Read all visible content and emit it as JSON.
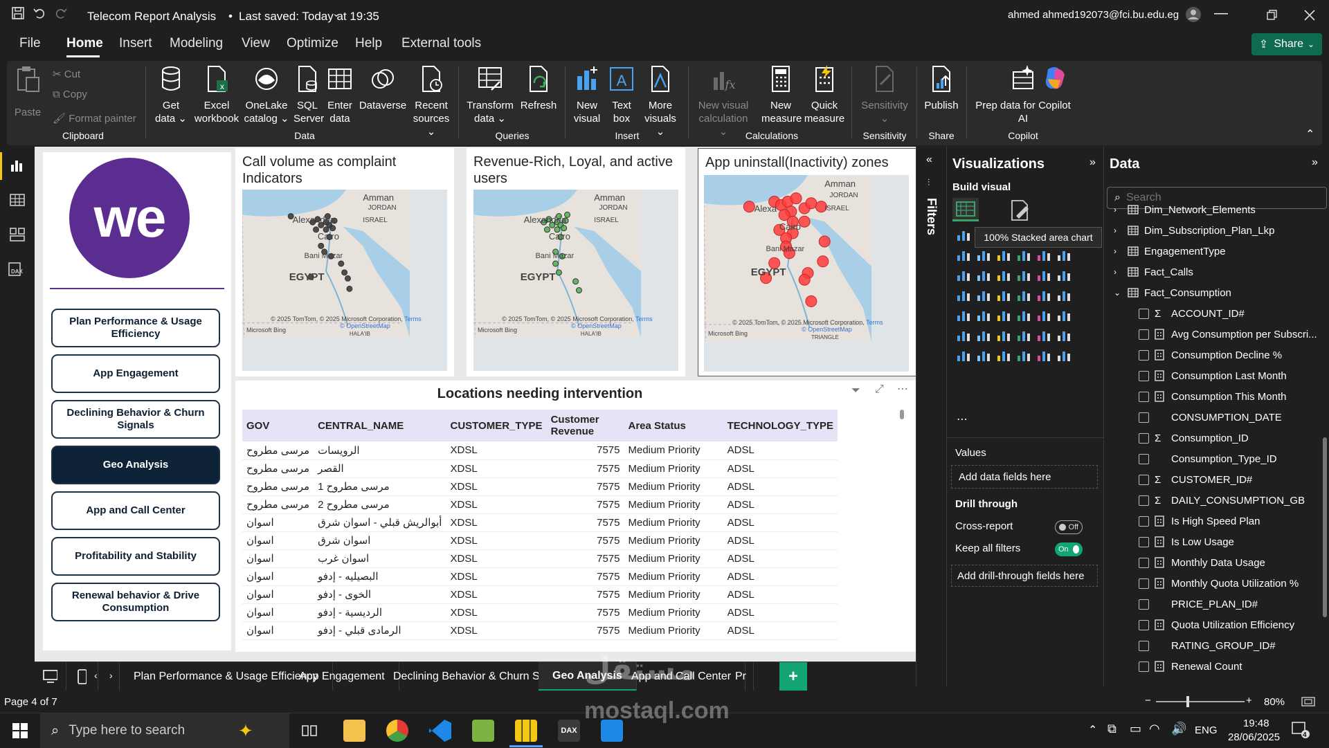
{
  "titlebar": {
    "title": "Telecom Report Analysis",
    "saved": "Last saved: Today at 19:35",
    "user": "ahmed ahmed192073@fci.bu.edu.eg"
  },
  "menu": [
    "File",
    "Home",
    "Insert",
    "Modeling",
    "View",
    "Optimize",
    "Help",
    "External tools"
  ],
  "share_label": "Share",
  "ribbon": {
    "clipboard": {
      "paste": "Paste",
      "cut": "Cut",
      "copy": "Copy",
      "format_painter": "Format painter",
      "group": "Clipboard"
    },
    "data": {
      "get_data_1": "Get",
      "get_data_2": "data",
      "excel_1": "Excel",
      "excel_2": "workbook",
      "onelake_1": "OneLake",
      "onelake_2": "catalog",
      "sql_1": "SQL",
      "sql_2": "Server",
      "enter_1": "Enter",
      "enter_2": "data",
      "dataverse": "Dataverse",
      "recent_1": "Recent",
      "recent_2": "sources",
      "group": "Data"
    },
    "queries": {
      "transform_1": "Transform",
      "transform_2": "data",
      "refresh": "Refresh",
      "group": "Queries"
    },
    "insert": {
      "new_visual_1": "New",
      "new_visual_2": "visual",
      "text_box_1": "Text",
      "text_box_2": "box",
      "more_visuals_1": "More",
      "more_visuals_2": "visuals",
      "group": "Insert"
    },
    "calculations": {
      "new_calc_1": "New visual",
      "new_calc_2": "calculation",
      "new_measure_1": "New",
      "new_measure_2": "measure",
      "quick_measure_1": "Quick",
      "quick_measure_2": "measure",
      "group": "Calculations"
    },
    "sensitivity": {
      "label": "Sensitivity",
      "group": "Sensitivity"
    },
    "share": {
      "publish": "Publish",
      "group": "Share"
    },
    "copilot": {
      "label_1": "Prep data for Copilot",
      "label_2": "AI",
      "group": "Copilot"
    }
  },
  "nav_buttons": [
    "Plan Performance & Usage Efficiency",
    "App Engagement",
    "Declining Behavior & Churn Signals",
    "Geo Analysis",
    "App and Call Center",
    "Profitability and Stability",
    "Renewal behavior & Drive Consumption"
  ],
  "logo_text": "we",
  "maps": [
    {
      "title": "Call volume as complaint Indicators",
      "labels": [
        "Amman",
        "JORDAN",
        "ISRAEL",
        "Alexandria",
        "Cairo",
        "Bani Mazar",
        "EGYPT"
      ],
      "credit": "© 2025 TomTom, © 2025 Microsoft Corporation,",
      "terms": "Terms",
      "osm": "© OpenStreetMap",
      "bing": "Microsoft Bing",
      "halaib": "HALA'IB"
    },
    {
      "title": "Revenue-Rich, Loyal, and active users",
      "labels": [
        "Amman",
        "JORDAN",
        "ISRAEL",
        "Alexandria",
        "Cairo",
        "Bani Mazar",
        "EGYPT"
      ],
      "credit": "© 2025 TomTom, © 2025 Microsoft Corporation,",
      "terms": "Terms",
      "osm": "© OpenStreetMap",
      "bing": "Microsoft Bing",
      "halaib": "HALA'IB"
    },
    {
      "title": "App uninstall(Inactivity) zones",
      "labels": [
        "Amman",
        "JORDAN",
        "ISRAEL",
        "Alexa",
        "Cairo",
        "Bani Mazar",
        "EGYPT"
      ],
      "credit": "© 2025 TomTom, © 2025 Microsoft Corporation,",
      "terms": "Terms",
      "osm": "© OpenStreetMap",
      "bing": "Microsoft Bing",
      "halaib": "TRIANGLE"
    }
  ],
  "table": {
    "title": "Locations needing intervention",
    "headers": [
      "GOV",
      "CENTRAL_NAME",
      "CUSTOMER_TYPE",
      "Customer Revenue",
      "Area Status",
      "TECHNOLOGY_TYPE"
    ],
    "rows": [
      [
        "مرسى مطروح",
        "الرويسات",
        "XDSL",
        "7575",
        "Medium Priority",
        "ADSL"
      ],
      [
        "مرسى مطروح",
        "القصر",
        "XDSL",
        "7575",
        "Medium Priority",
        "ADSL"
      ],
      [
        "مرسى مطروح",
        "مرسى مطروح 1",
        "XDSL",
        "7575",
        "Medium Priority",
        "ADSL"
      ],
      [
        "مرسى مطروح",
        "مرسى مطروح 2",
        "XDSL",
        "7575",
        "Medium Priority",
        "ADSL"
      ],
      [
        "اسوان",
        "أبوالريش قبلي - اسوان شرق",
        "XDSL",
        "7575",
        "Medium Priority",
        "ADSL"
      ],
      [
        "اسوان",
        "اسوان شرق",
        "XDSL",
        "7575",
        "Medium Priority",
        "ADSL"
      ],
      [
        "اسوان",
        "اسوان غرب",
        "XDSL",
        "7575",
        "Medium Priority",
        "ADSL"
      ],
      [
        "اسوان",
        "البصيليه - إدفو",
        "XDSL",
        "7575",
        "Medium Priority",
        "ADSL"
      ],
      [
        "اسوان",
        "الخوى - إدفو",
        "XDSL",
        "7575",
        "Medium Priority",
        "ADSL"
      ],
      [
        "اسوان",
        "الرديسية - إدفو",
        "XDSL",
        "7575",
        "Medium Priority",
        "ADSL"
      ],
      [
        "اسوان",
        "الرمادى قبلي - إدفو",
        "XDSL",
        "7575",
        "Medium Priority",
        "ADSL"
      ]
    ]
  },
  "filters_label": "Filters",
  "viz": {
    "title": "Visualizations",
    "build": "Build visual",
    "tooltip": "100% Stacked area chart",
    "values": "Values",
    "add_fields": "Add data fields here",
    "drill": "Drill through",
    "cross": "Cross-report",
    "cross_state": "Off",
    "keep": "Keep all filters",
    "keep_state": "On",
    "add_drill": "Add drill-through fields here"
  },
  "data_pane": {
    "title": "Data",
    "search_placeholder": "Search",
    "tables": [
      "Dim_Network_Elements",
      "Dim_Subscription_Plan_Lkp",
      "EngagementType",
      "Fact_Calls",
      "Fact_Consumption"
    ],
    "fields": [
      {
        "name": "ACCOUNT_ID#",
        "icon": "sigma"
      },
      {
        "name": "Avg Consumption per Subscri...",
        "icon": "calc"
      },
      {
        "name": "Consumption Decline %",
        "icon": "calc"
      },
      {
        "name": "Consumption Last Month",
        "icon": "calc"
      },
      {
        "name": "Consumption This Month",
        "icon": "calc"
      },
      {
        "name": "CONSUMPTION_DATE",
        "icon": "none"
      },
      {
        "name": "Consumption_ID",
        "icon": "sigma"
      },
      {
        "name": "Consumption_Type_ID",
        "icon": "none"
      },
      {
        "name": "CUSTOMER_ID#",
        "icon": "sigma"
      },
      {
        "name": "DAILY_CONSUMPTION_GB",
        "icon": "sigma"
      },
      {
        "name": "Is High Speed Plan",
        "icon": "calc"
      },
      {
        "name": "Is Low Usage",
        "icon": "calc"
      },
      {
        "name": "Monthly Data Usage",
        "icon": "calc"
      },
      {
        "name": "Monthly Quota Utilization %",
        "icon": "calc"
      },
      {
        "name": "PRICE_PLAN_ID#",
        "icon": "none"
      },
      {
        "name": "Quota Utilization Efficiency",
        "icon": "calc"
      },
      {
        "name": "RATING_GROUP_ID#",
        "icon": "none"
      },
      {
        "name": "Renewal Count",
        "icon": "calc"
      }
    ]
  },
  "page_tabs": [
    "Plan Performance & Usage Efficiency",
    "App Engagement",
    "Declining Behavior & Churn Signals",
    "Geo Analysis",
    "App and Call Center",
    "Pr"
  ],
  "status": {
    "page": "Page 4 of 7",
    "zoom": "80%"
  },
  "taskbar": {
    "search": "Type here to search",
    "lang": "ENG",
    "time": "19:48",
    "date": "28/06/2025",
    "notif": "4"
  },
  "watermark": {
    "arabic": "مستقل",
    "latin": "mostaql.com"
  }
}
